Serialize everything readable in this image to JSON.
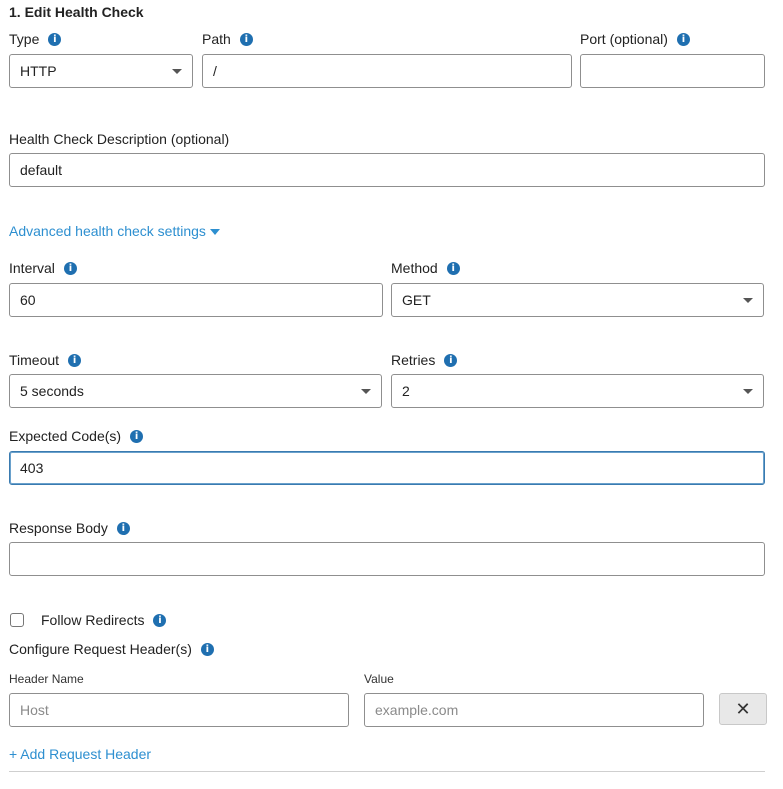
{
  "section": {
    "title": "1. Edit Health Check"
  },
  "type_field": {
    "label": "Type",
    "value": "HTTP"
  },
  "path_field": {
    "label": "Path",
    "value": "/"
  },
  "port_field": {
    "label": "Port (optional)",
    "value": ""
  },
  "description_field": {
    "label": "Health Check Description (optional)",
    "value": "default"
  },
  "advanced": {
    "label": "Advanced health check settings"
  },
  "interval_field": {
    "label": "Interval",
    "value": "60"
  },
  "method_field": {
    "label": "Method",
    "value": "GET"
  },
  "timeout_field": {
    "label": "Timeout",
    "value": "5 seconds"
  },
  "retries_field": {
    "label": "Retries",
    "value": "2"
  },
  "expected_codes_field": {
    "label": "Expected Code(s)",
    "value": "403"
  },
  "response_body_field": {
    "label": "Response Body",
    "value": ""
  },
  "follow_redirects": {
    "label": "Follow Redirects",
    "checked": false
  },
  "request_headers": {
    "label": "Configure Request Header(s)",
    "header_name_label": "Header Name",
    "header_name_placeholder": "Host",
    "value_label": "Value",
    "value_placeholder": "example.com",
    "remove_glyph": "✕",
    "add_label": "+ Add Request Header"
  },
  "icons": {
    "info": "i"
  },
  "colors": {
    "accent": "#2d8fd0",
    "info_icon": "#1f6fb0",
    "focus_border": "#3a7bb0"
  }
}
